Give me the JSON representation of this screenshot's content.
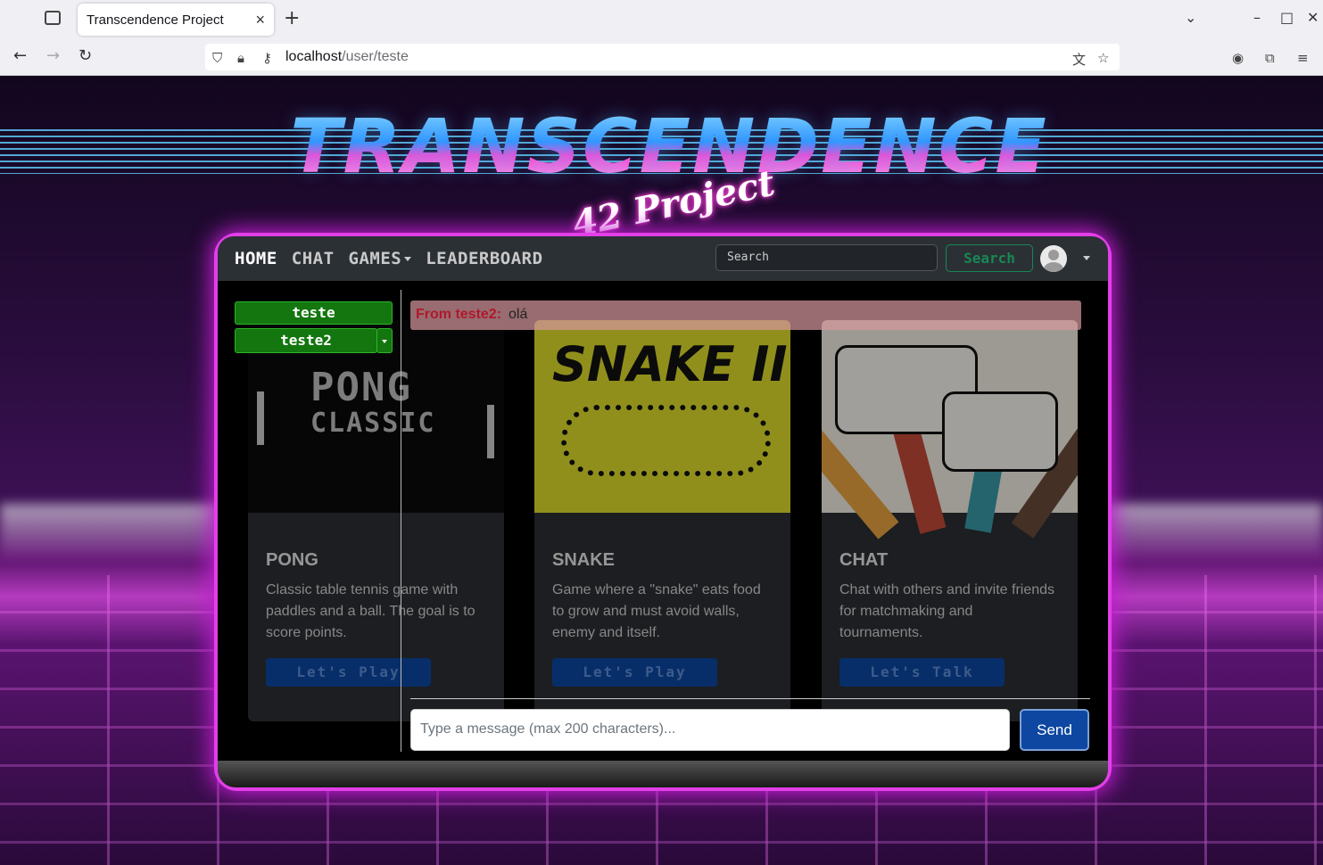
{
  "browser": {
    "tab_title": "Transcendence Project",
    "tab_close": "×",
    "new_tab": "+",
    "url_host": "localhost",
    "url_path": "/user/teste"
  },
  "header": {
    "logo_title": "TRANSCENDENCE",
    "logo_subtitle": "42 Project"
  },
  "nav": {
    "home": "HOME",
    "chat": "CHAT",
    "games": "GAMES",
    "leaderboard": "LEADERBOARD",
    "search_placeholder": "Search",
    "search_button": "Search"
  },
  "cards": [
    {
      "image_text_1": "PONG",
      "image_text_2": "CLASSIC",
      "title": "PONG",
      "desc": "Classic table tennis game with paddles and a ball. The goal is to score points.",
      "button": "Let's Play"
    },
    {
      "image_text": "SNAKE II",
      "title": "SNAKE",
      "desc": "Game where a \"snake\" eats food to grow and must avoid walls, enemy and itself.",
      "button": "Let's Play"
    },
    {
      "title": "CHAT",
      "desc": "Chat with others and invite friends for matchmaking and tournaments.",
      "button": "Let's Talk"
    }
  ],
  "chat": {
    "users": [
      "teste",
      "teste2"
    ],
    "message_from": "From teste2:",
    "message_text": "olá",
    "input_placeholder": "Type a message (max 200 characters)...",
    "send_button": "Send"
  },
  "colors": {
    "frame_glow": "#e23fe8",
    "success": "#198754",
    "primary": "#0d47a1"
  }
}
